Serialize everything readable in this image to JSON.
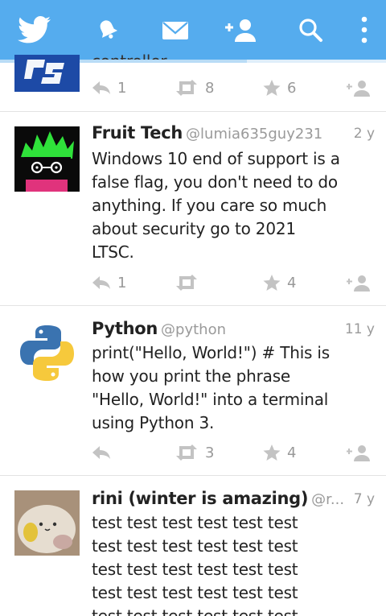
{
  "toolbar": {
    "icons": [
      "bird-logo-icon",
      "notifications-bell-icon",
      "messages-envelope-icon",
      "follow-user-icon",
      "search-icon",
      "overflow-menu-icon"
    ]
  },
  "tweets": [
    {
      "avatar": "playstation-logo-avatar",
      "partial_text": "controller",
      "replies": "1",
      "retweets": "8",
      "favorites": "6"
    },
    {
      "name": "Fruit Tech",
      "handle": "@lumia635guy231",
      "time": "2 y",
      "lines": [
        "Windows 10 end of support is a",
        "false flag, you don't need to do",
        "anything. If you care so much",
        "about security go to 2021",
        "LTSC."
      ],
      "replies": "1",
      "retweets": "",
      "favorites": "4"
    },
    {
      "name": "Python",
      "handle": "@python",
      "time": "11 y",
      "lines": [
        "print(\"Hello, World!\") # This is",
        "how you print the phrase",
        "\"Hello, World!\" into a terminal",
        "using Python 3."
      ],
      "replies": "",
      "retweets": "3",
      "favorites": "4"
    },
    {
      "name": "rini (winter is amazing)",
      "handle": "@r...",
      "time": "7 y",
      "lines": [
        "test test test test test test",
        "test test test test test test",
        "test test test test test test",
        "test test test test test test",
        "test test test test test test"
      ]
    }
  ],
  "colors": {
    "header": "#55acee",
    "text": "#222222",
    "muted": "#9a9a9a",
    "action": "#b9b9b9",
    "divider": "#e3e3e3"
  }
}
